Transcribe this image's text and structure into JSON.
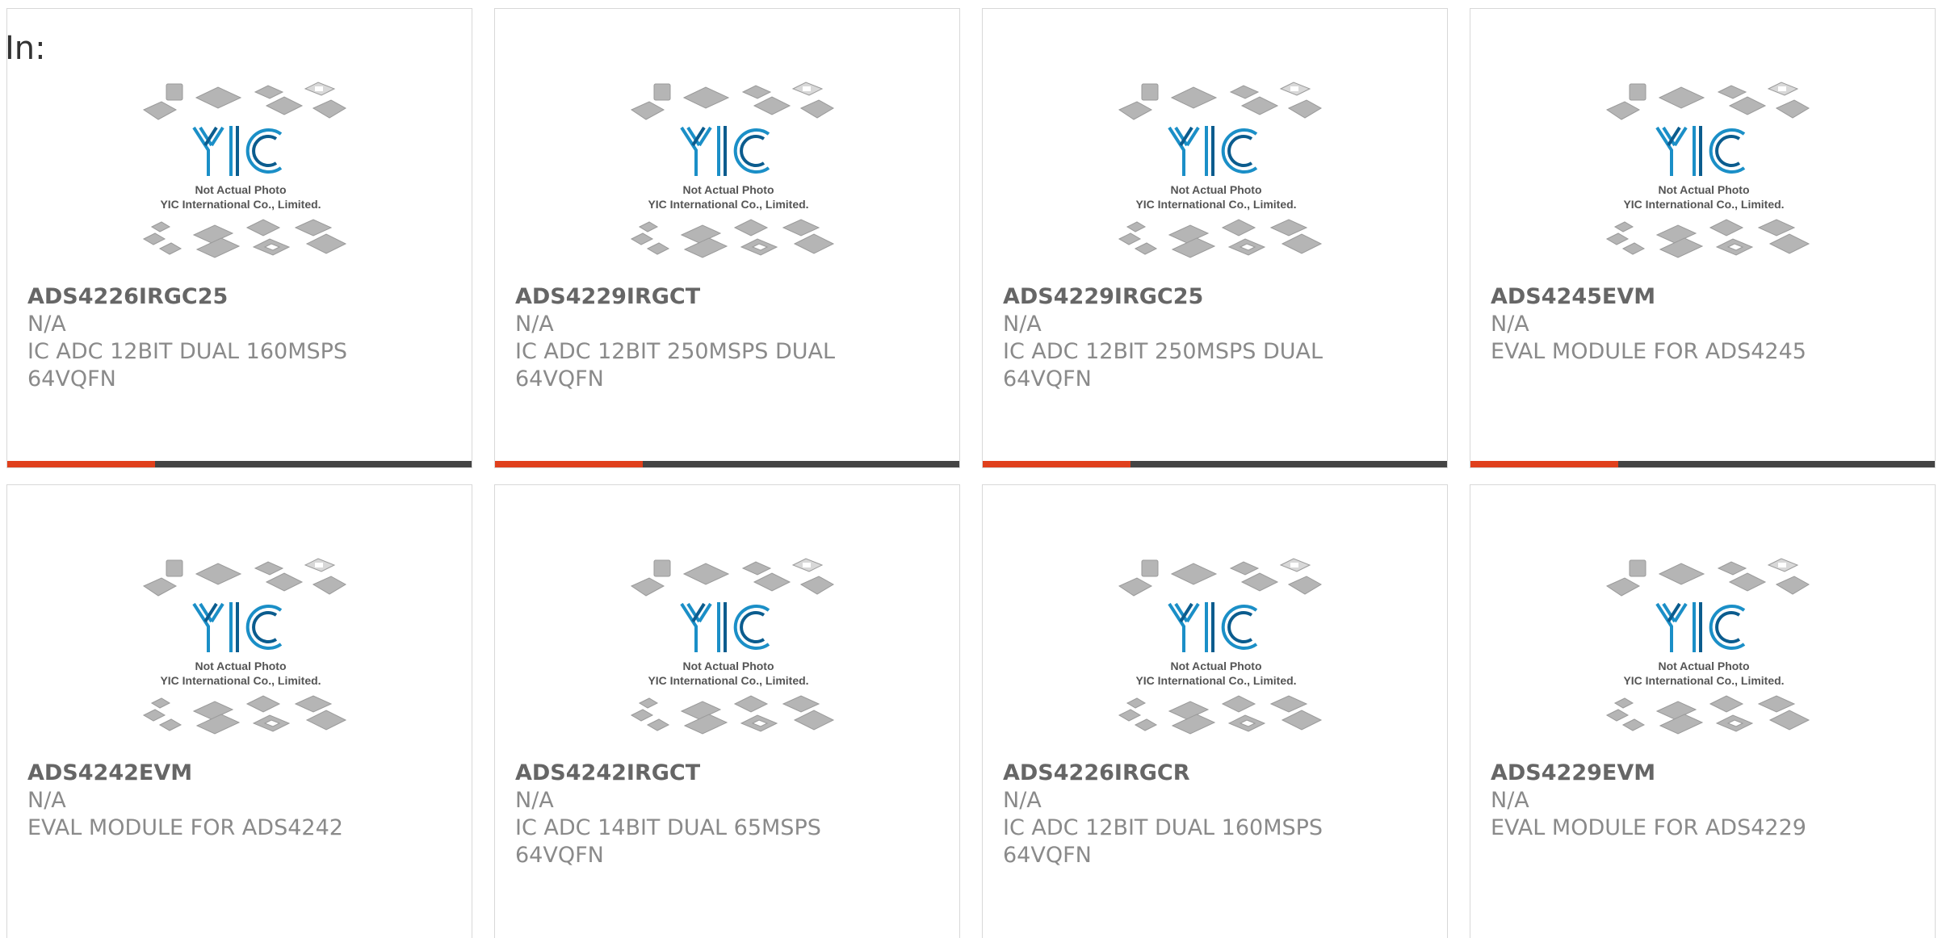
{
  "header": {
    "in_label": "In:"
  },
  "placeholder_photo": {
    "brand": "YIC",
    "line1": "Not Actual Photo",
    "line2": "YIC International Co., Limited."
  },
  "colors": {
    "accent": "#e0401c",
    "bar": "#444444",
    "logo": "#1b8fc7",
    "chip": "#b8b8b8"
  },
  "products": [
    {
      "part": "ADS4226IRGC25",
      "manufacturer": "N/A",
      "desc1": "IC ADC 12BIT DUAL 160MSPS",
      "desc2": "64VQFN"
    },
    {
      "part": "ADS4229IRGCT",
      "manufacturer": "N/A",
      "desc1": "IC ADC 12BIT 250MSPS DUAL",
      "desc2": "64VQFN"
    },
    {
      "part": "ADS4229IRGC25",
      "manufacturer": "N/A",
      "desc1": "IC ADC 12BIT 250MSPS DUAL",
      "desc2": "64VQFN"
    },
    {
      "part": "ADS4245EVM",
      "manufacturer": "N/A",
      "desc1": "EVAL MODULE FOR ADS4245",
      "desc2": ""
    },
    {
      "part": "ADS4242EVM",
      "manufacturer": "N/A",
      "desc1": "EVAL MODULE FOR ADS4242",
      "desc2": ""
    },
    {
      "part": "ADS4242IRGCT",
      "manufacturer": "N/A",
      "desc1": "IC ADC 14BIT DUAL 65MSPS",
      "desc2": "64VQFN"
    },
    {
      "part": "ADS4226IRGCR",
      "manufacturer": "N/A",
      "desc1": "IC ADC 12BIT DUAL 160MSPS",
      "desc2": "64VQFN"
    },
    {
      "part": "ADS4229EVM",
      "manufacturer": "N/A",
      "desc1": "EVAL MODULE FOR ADS4229",
      "desc2": ""
    }
  ]
}
